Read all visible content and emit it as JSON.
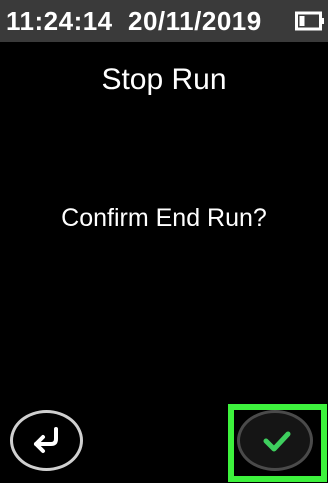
{
  "status_bar": {
    "time": "11:24:14",
    "date": "20/11/2019",
    "battery_icon": "battery-icon"
  },
  "dialog": {
    "title": "Stop Run",
    "message": "Confirm End Run?"
  },
  "actions": {
    "back_icon": "return-arrow-icon",
    "confirm_icon": "checkmark-icon",
    "confirm_color": "#3ecf5e",
    "highlight_color": "#3df23d"
  }
}
